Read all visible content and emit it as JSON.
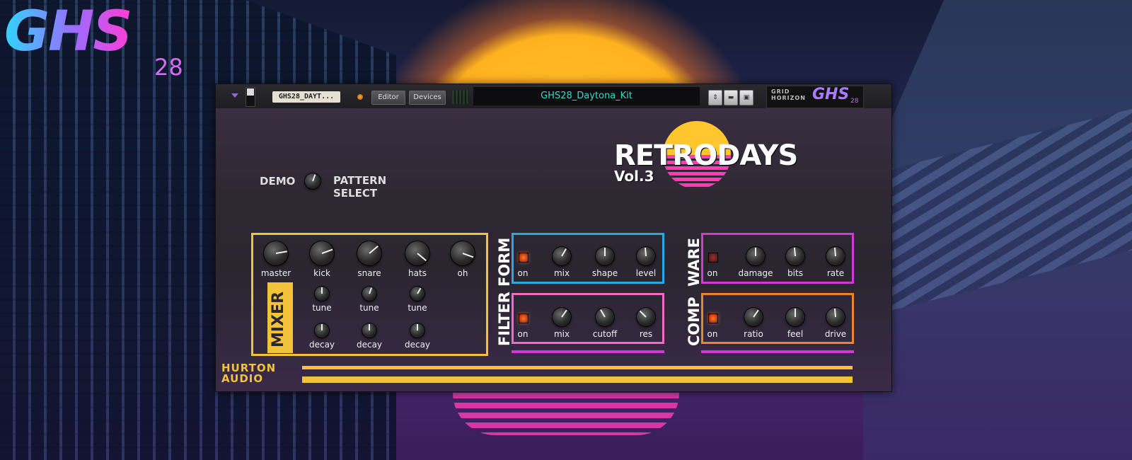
{
  "logo": {
    "brand": "GHS",
    "number": "28"
  },
  "topbar": {
    "patch_name": "GHS28_DAYT...",
    "editor_label": "Editor",
    "devices_label": "Devices",
    "preset_name": "GHS28_Daytona_Kit",
    "badge": {
      "line1": "GRID",
      "line2": "HORIZON",
      "brand": "GHS",
      "number": "28"
    }
  },
  "title": {
    "main": "RETRODAYS",
    "sub": "Vol.3"
  },
  "demo": {
    "label": "DEMO",
    "pattern_line1": "PATTERN",
    "pattern_line2": "SELECT"
  },
  "mixer": {
    "label": "MIXER",
    "top": [
      "master",
      "kick",
      "snare",
      "hats",
      "oh"
    ],
    "tune": [
      "tune",
      "tune",
      "tune"
    ],
    "decay": [
      "decay",
      "decay",
      "decay"
    ]
  },
  "form": {
    "label": "FORM",
    "controls": [
      "on",
      "mix",
      "shape",
      "level"
    ],
    "state": "on"
  },
  "filter": {
    "label": "FILTER",
    "controls": [
      "on",
      "mix",
      "cutoff",
      "res"
    ],
    "state": "on"
  },
  "ware": {
    "label": "WARE",
    "controls": [
      "on",
      "damage",
      "bits",
      "rate"
    ],
    "state": "off"
  },
  "comp": {
    "label": "COMP",
    "controls": [
      "on",
      "ratio",
      "feel",
      "drive"
    ],
    "state": "on"
  },
  "footer": {
    "brand_line1": "HURTON",
    "brand_line2": "AUDIO"
  },
  "colors": {
    "mixer": "#f2c23a",
    "form": "#2aa7e0",
    "filter": "#f06ac8",
    "ware": "#d23ad6",
    "comp": "#e8872a",
    "accent": "#ff3db5"
  },
  "icons": {
    "updown": "up-down-arrow-icon",
    "folder": "folder-icon",
    "save": "save-icon"
  }
}
